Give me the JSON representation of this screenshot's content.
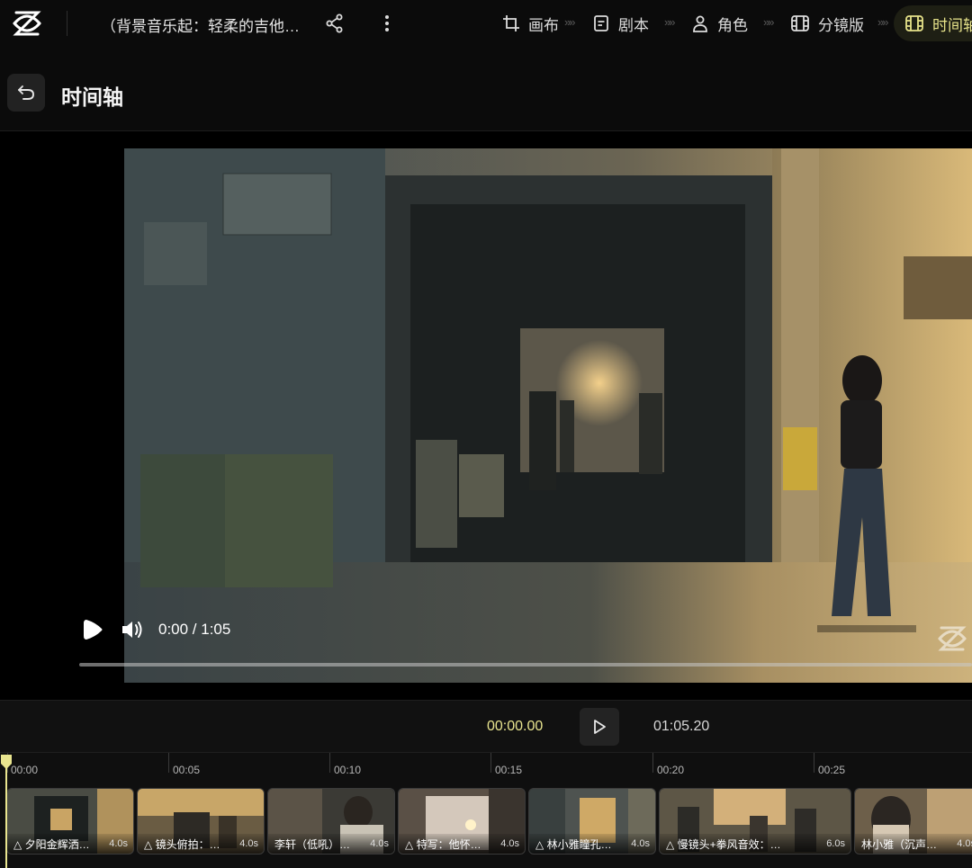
{
  "topbar": {
    "project_title": "（背景音乐起：轻柔的吉他…",
    "nav": [
      {
        "label": "画布",
        "icon": "crop-icon"
      },
      {
        "label": "剧本",
        "icon": "script-icon"
      },
      {
        "label": "角色",
        "icon": "user-icon"
      },
      {
        "label": "分镜版",
        "icon": "film-icon"
      },
      {
        "label": "时间轴",
        "icon": "timeline-icon",
        "active": true
      }
    ],
    "separator": "»»",
    "accent": "#e7e38a"
  },
  "header": {
    "title": "时间轴"
  },
  "player": {
    "time": "0:00 / 1:05",
    "progress": 0
  },
  "timeline": {
    "current_time": "00:00.00",
    "total_time": "01:05.20",
    "ruler": [
      "00:00",
      "00:05",
      "00:10",
      "00:15",
      "00:20",
      "00:25"
    ],
    "clips": [
      {
        "label": "△ 夕阳金辉洒…",
        "duration": "4.0s"
      },
      {
        "label": "△ 镜头俯拍：…",
        "duration": "4.0s"
      },
      {
        "label": "李轩（低吼）…",
        "duration": "4.0s"
      },
      {
        "label": "△ 特写：他怀…",
        "duration": "4.0s"
      },
      {
        "label": "△ 林小雅瞳孔…",
        "duration": "4.0s"
      },
      {
        "label": "△ 慢镜头+拳风音效：…",
        "duration": "6.0s"
      },
      {
        "label": "林小雅（沉声…",
        "duration": "4.0s"
      }
    ]
  }
}
